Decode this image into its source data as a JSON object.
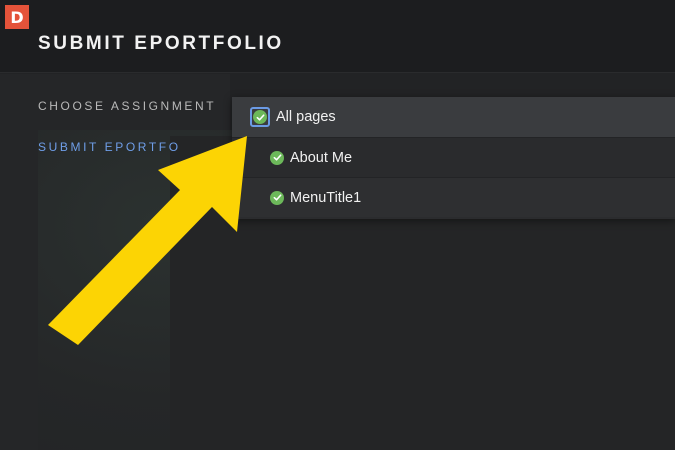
{
  "brand": {
    "badge": "D"
  },
  "header": {
    "title": "SUBMIT EPORTFOLIO"
  },
  "sidebar": {
    "items": [
      {
        "label": "CHOOSE ASSIGNMENT"
      },
      {
        "label": "SUBMIT EPORTFO"
      }
    ]
  },
  "dropdown": {
    "options": [
      {
        "label": "All pages",
        "checked": true,
        "focused": true
      },
      {
        "label": "About Me",
        "checked": true
      },
      {
        "label": "MenuTitle1",
        "checked": true
      }
    ]
  },
  "annotation": {
    "arrow_color": "#fcd404"
  },
  "colors": {
    "accent": "#6f9ee8",
    "check": "#6cb85a",
    "brand": "#e4533a"
  }
}
